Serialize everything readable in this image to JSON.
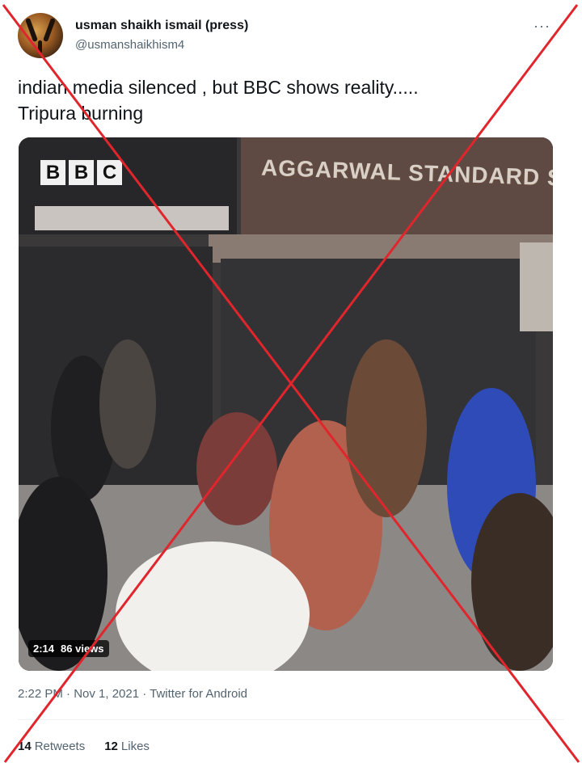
{
  "tweet": {
    "author_name": "usman shaikh ismail (press)",
    "author_handle": "@usmanshaikhism4",
    "more_icon": "···",
    "text_line1": "indian media silenced , but BBC shows reality.....",
    "text_line2": "Tripura burning",
    "timestamp": "2:22 PM · Nov 1, 2021 · Twitter for Android",
    "retweets_count": "14",
    "retweets_label": "Retweets",
    "likes_count": "12",
    "likes_label": "Likes"
  },
  "media": {
    "bbc_letters": [
      "B",
      "B",
      "C"
    ],
    "shop_sign": "AGGARWAL STANDARD SWEETS",
    "duration": "2:14",
    "views": "86 views"
  },
  "colors": {
    "fact_check_cross": "#e0262c",
    "text_primary": "#0f1419",
    "text_secondary": "#536471"
  }
}
